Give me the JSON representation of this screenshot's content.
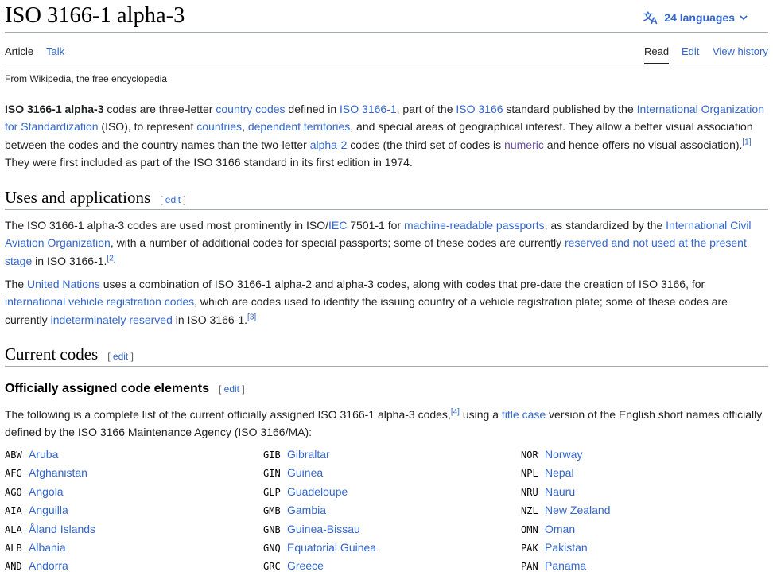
{
  "header": {
    "title": "ISO 3166-1 alpha-3",
    "languages_label": "24 languages"
  },
  "tabs": {
    "article": "Article",
    "talk": "Talk",
    "read": "Read",
    "edit": "Edit",
    "view_history": "View history"
  },
  "tagline": "From Wikipedia, the free encyclopedia",
  "intro": {
    "bold": "ISO 3166-1 alpha-3",
    "t1": " codes are three-letter ",
    "l1": "country codes",
    "t2": " defined in ",
    "l2": "ISO 3166-1",
    "t3": ", part of the ",
    "l3": "ISO 3166",
    "t4": " standard published by the ",
    "l4": "International Organization for Standardization",
    "t5": " (ISO), to represent ",
    "l5": "countries",
    "t6": ", ",
    "l6": "dependent territories",
    "t7": ", and special areas of geographical interest. They allow a better visual association between the codes and the country names than the two-letter ",
    "l7": "alpha-2",
    "t8": " codes (the third set of codes is ",
    "l8": "numeric",
    "t9": " and hence offers no visual association).",
    "ref1": "[1]",
    "t10": " They were first included as part of the ISO 3166 standard in its first edition in 1974."
  },
  "uses": {
    "heading": "Uses and applications",
    "edit_label": "edit",
    "p1": {
      "t1": "The ISO 3166-1 alpha-3 codes are used most prominently in ISO/",
      "l1": "IEC",
      "t2": " 7501-1 for ",
      "l2": "machine-readable passports",
      "t3": ", as standardized by the ",
      "l3": "International Civil Aviation Organization",
      "t4": ", with a number of additional codes for special passports; some of these codes are currently ",
      "l4": "reserved and not used at the present stage",
      "t5": " in ISO 3166-1.",
      "ref": "[2]"
    },
    "p2": {
      "t1": "The ",
      "l1": "United Nations",
      "t2": " uses a combination of ISO 3166-1 alpha-2 and alpha-3 codes, along with codes that pre-date the creation of ISO 3166, for ",
      "l2": "international vehicle registration codes",
      "t3": ", which are codes used to identify the issuing country of a vehicle registration plate; some of these codes are currently ",
      "l3": "indeterminately reserved",
      "t4": " in ISO 3166-1.",
      "ref": "[3]"
    }
  },
  "current": {
    "heading": "Current codes",
    "edit_label": "edit"
  },
  "official": {
    "heading": "Officially assigned code elements",
    "edit_label": "edit",
    "t1": "The following is a complete list of the current officially assigned ISO 3166-1 alpha-3 codes,",
    "ref": "[4]",
    "t2": " using a ",
    "l1": "title case",
    "t3": " version of the English short names officially defined by the ISO 3166 Maintenance Agency (ISO 3166/MA):"
  },
  "code_columns": [
    [
      {
        "code": "ABW",
        "name": "Aruba"
      },
      {
        "code": "AFG",
        "name": "Afghanistan"
      },
      {
        "code": "AGO",
        "name": "Angola"
      },
      {
        "code": "AIA",
        "name": "Anguilla"
      },
      {
        "code": "ALA",
        "name": "Åland Islands"
      },
      {
        "code": "ALB",
        "name": "Albania"
      },
      {
        "code": "AND",
        "name": "Andorra"
      }
    ],
    [
      {
        "code": "GIB",
        "name": "Gibraltar"
      },
      {
        "code": "GIN",
        "name": "Guinea"
      },
      {
        "code": "GLP",
        "name": "Guadeloupe"
      },
      {
        "code": "GMB",
        "name": "Gambia"
      },
      {
        "code": "GNB",
        "name": "Guinea-Bissau"
      },
      {
        "code": "GNQ",
        "name": "Equatorial Guinea"
      },
      {
        "code": "GRC",
        "name": "Greece"
      }
    ],
    [
      {
        "code": "NOR",
        "name": "Norway"
      },
      {
        "code": "NPL",
        "name": "Nepal"
      },
      {
        "code": "NRU",
        "name": "Nauru"
      },
      {
        "code": "NZL",
        "name": "New Zealand"
      },
      {
        "code": "OMN",
        "name": "Oman"
      },
      {
        "code": "PAK",
        "name": "Pakistan"
      },
      {
        "code": "PAN",
        "name": "Panama"
      }
    ]
  ],
  "colors": {
    "link": "#3366cc",
    "visited_link": "#6b4ba1",
    "text": "#202122",
    "border": "#a2a9b1"
  },
  "icons": {
    "language": "translate-icon",
    "dropdown": "chevron-down-icon"
  }
}
